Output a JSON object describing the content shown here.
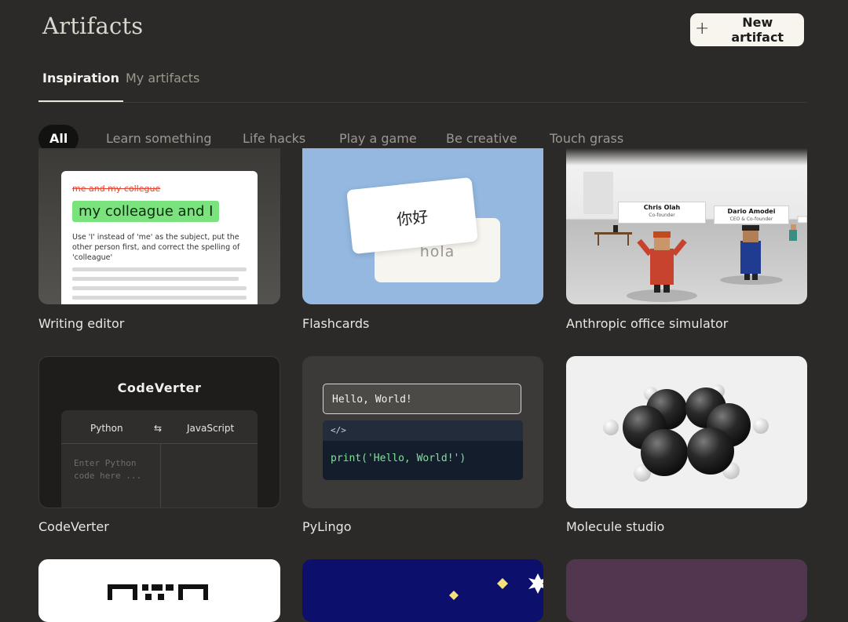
{
  "page_title": "Artifacts",
  "new_button": {
    "label": "New artifact"
  },
  "tabs": [
    {
      "label": "Inspiration",
      "active": true
    },
    {
      "label": "My artifacts",
      "active": false
    }
  ],
  "filters": [
    {
      "label": "All",
      "active": true
    },
    {
      "label": "Learn something"
    },
    {
      "label": "Life hacks"
    },
    {
      "label": "Play a game"
    },
    {
      "label": "Be creative"
    },
    {
      "label": "Touch grass"
    }
  ],
  "cards": [
    {
      "title": "Writing editor",
      "preview": {
        "strike": "me and my collegue",
        "suggestion": "my colleague and I",
        "note": "Use 'I' instead of 'me' as the subject, put the other person first, and correct the spelling of 'colleague'"
      }
    },
    {
      "title": "Flashcards",
      "preview": {
        "front": "你好",
        "back": "hola"
      }
    },
    {
      "title": "Anthropic office simulator",
      "preview": {
        "sign1_name": "Chris Olah",
        "sign1_role": "Co-founder",
        "sign2_name": "Dario Amodei",
        "sign2_role": "CEO & Co-founder"
      }
    },
    {
      "title": "CodeVerter",
      "preview": {
        "heading": "CodeVerter",
        "from": "Python",
        "swap": "⇆",
        "to": "JavaScript",
        "placeholder": "Enter Python code here ..."
      }
    },
    {
      "title": "PyLingo",
      "preview": {
        "input": "Hello, World!",
        "code_header": "</>",
        "code": "print('Hello, World!')"
      }
    },
    {
      "title": "Molecule studio"
    }
  ],
  "colors": {
    "background": "#2b2a28",
    "flashcards": "#94b8e0",
    "suggestion": "#7be37e",
    "strike": "#e1432f",
    "stars_bg": "#0c0f6b",
    "purple_bg": "#52364f"
  }
}
